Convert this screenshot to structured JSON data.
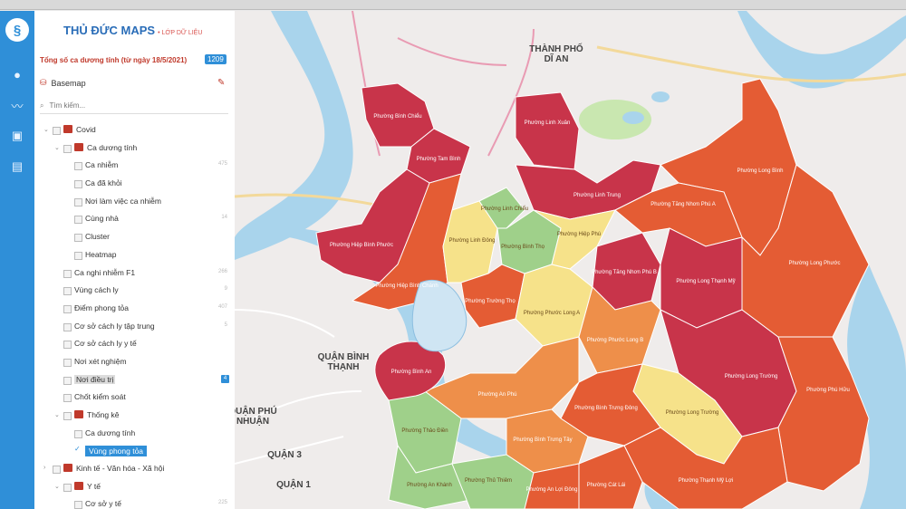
{
  "app": {
    "title": "THỦ ĐỨC MAPS",
    "subtitle": "• LỚP DỮ LIỆU",
    "total_label": "Tổng số ca dương tính (từ ngày 18/5/2021)",
    "total_count": "1209",
    "basemap_label": "Basemap",
    "search_placeholder": "Tìm kiếm..."
  },
  "colors": {
    "rail": "#2f8fd8",
    "red": "#c8344a",
    "orange_red": "#e45c34",
    "orange": "#ee8f4a",
    "yellow": "#f6e28a",
    "green": "#9fd08a",
    "water": "#a9d4ec"
  },
  "rail_icons": [
    "globe-icon",
    "trend-icon",
    "image-icon",
    "table-icon"
  ],
  "layers": [
    {
      "label": "Covid",
      "level": 0,
      "expand": "down",
      "num": "",
      "icon": "folder-icon"
    },
    {
      "label": "Ca dương tính",
      "level": 1,
      "expand": "down",
      "num": "",
      "icon": "folder-icon"
    },
    {
      "label": "Ca nhiễm",
      "level": 2,
      "num": "475"
    },
    {
      "label": "Ca đã khỏi",
      "level": 2,
      "num": ""
    },
    {
      "label": "Nơi làm việc ca nhiễm",
      "level": 2,
      "num": ""
    },
    {
      "label": "Cùng nhà",
      "level": 2,
      "num": "14"
    },
    {
      "label": "Cluster",
      "level": 2,
      "num": ""
    },
    {
      "label": "Heatmap",
      "level": 2,
      "num": ""
    },
    {
      "label": "Ca nghi nhiễm F1",
      "level": 1,
      "num": "266"
    },
    {
      "label": "Vùng cách ly",
      "level": 1,
      "num": "9"
    },
    {
      "label": "Điểm phong tỏa",
      "level": 1,
      "num": "407"
    },
    {
      "label": "Cơ sở cách ly tập trung",
      "level": 1,
      "num": "5"
    },
    {
      "label": "Cơ sở cách ly y tế",
      "level": 1,
      "num": ""
    },
    {
      "label": "Nơi xét nghiệm",
      "level": 1,
      "num": ""
    },
    {
      "label": "Nơi điều trị",
      "level": 1,
      "num": "",
      "badge": "4",
      "highlight": true
    },
    {
      "label": "Chốt kiểm soát",
      "level": 1,
      "num": ""
    },
    {
      "label": "Thống kê",
      "level": 1,
      "expand": "down",
      "num": "",
      "icon": "folder-icon"
    },
    {
      "label": "Ca dương tính",
      "level": 2,
      "num": ""
    },
    {
      "label": "Vùng phong tỏa",
      "level": 2,
      "num": "",
      "selected": true
    },
    {
      "label": "Kinh tế - Văn hóa - Xã hội",
      "level": 0,
      "expand": "right",
      "num": "",
      "icon": "folder-icon"
    },
    {
      "label": "Y tế",
      "level": 1,
      "expand": "down",
      "num": "",
      "icon": "folder-icon"
    },
    {
      "label": "Cơ sở y tế",
      "level": 2,
      "num": "225"
    }
  ],
  "map_labels": {
    "di_an": "THÀNH PHỐ\nDĨ AN",
    "binh_thanh": "QUẬN BÌNH\nTHẠNH",
    "phu_nhuan": "QUẬN PHÚ\nNHUẬN",
    "quan3": "QUẬN 3",
    "quan1": "QUẬN 1"
  },
  "wards": [
    {
      "name": "Phường Bình Chiểu",
      "zone": "red"
    },
    {
      "name": "Phường Tam Bình",
      "zone": "red"
    },
    {
      "name": "Phường Linh Xuân",
      "zone": "red"
    },
    {
      "name": "Phường Linh Trung",
      "zone": "red"
    },
    {
      "name": "Phường Hiệp Bình Phước",
      "zone": "red"
    },
    {
      "name": "Phường Hiệp Bình Chánh",
      "zone": "orange_red"
    },
    {
      "name": "Phường Linh Đông",
      "zone": "yellow"
    },
    {
      "name": "Phường Linh Chiểu",
      "zone": "green"
    },
    {
      "name": "Phường Bình Thọ",
      "zone": "green"
    },
    {
      "name": "Phường Hiệp Phú",
      "zone": "yellow"
    },
    {
      "name": "Phường Long Bình",
      "zone": "orange_red"
    },
    {
      "name": "Phường Tăng Nhơn Phú A",
      "zone": "orange_red"
    },
    {
      "name": "Phường Tăng Nhơn Phú B",
      "zone": "red"
    },
    {
      "name": "Phường Long Thạnh Mỹ",
      "zone": "red"
    },
    {
      "name": "Phường Trường Thọ",
      "zone": "orange_red"
    },
    {
      "name": "Phường Phước Long A",
      "zone": "yellow"
    },
    {
      "name": "Phường Phước Long B",
      "zone": "orange"
    },
    {
      "name": "Phường Long Trường",
      "zone": "red"
    },
    {
      "name": "Phường Long Phước",
      "zone": "orange_red"
    },
    {
      "name": "Phường Phú Hữu",
      "zone": "orange_red"
    },
    {
      "name": "Phường Long Trường",
      "zone": "yellow"
    },
    {
      "name": "Phường An Phú",
      "zone": "orange"
    },
    {
      "name": "Phường Bình Trưng Đông",
      "zone": "orange_red"
    },
    {
      "name": "Phường Bình Trưng Tây",
      "zone": "orange"
    },
    {
      "name": "Phường Thảo Điền",
      "zone": "green"
    },
    {
      "name": "Phường An Khánh",
      "zone": "green"
    },
    {
      "name": "Phường Thạnh Mỹ Lợi",
      "zone": "orange_red"
    },
    {
      "name": "Phường Cát Lái",
      "zone": "orange_red"
    },
    {
      "name": "Phường Thủ Thiêm",
      "zone": "green"
    },
    {
      "name": "Phường An Lợi Đông",
      "zone": "orange_red"
    },
    {
      "name": "Phường Bình An",
      "zone": "red"
    }
  ]
}
